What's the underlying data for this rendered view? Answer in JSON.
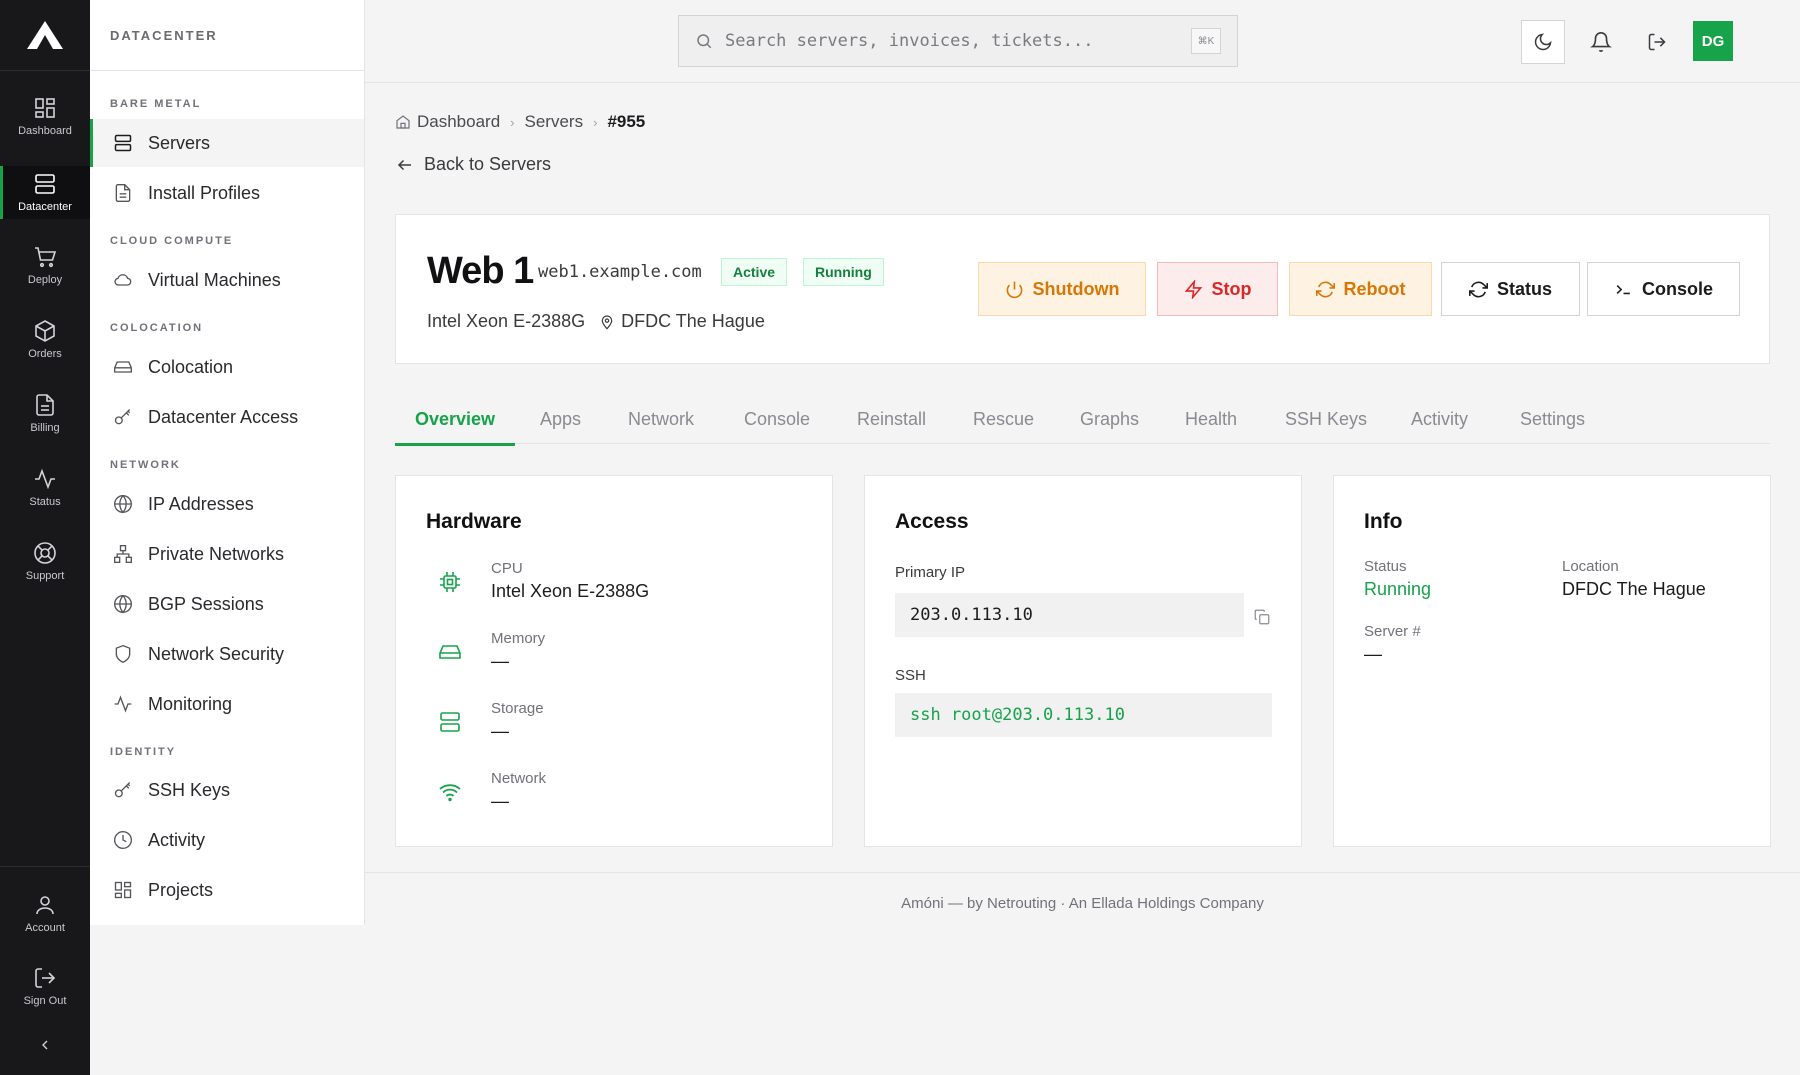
{
  "rail": {
    "items": [
      {
        "label": "Dashboard",
        "icon": "dashboard-icon"
      },
      {
        "label": "Datacenter",
        "icon": "server-icon"
      },
      {
        "label": "Deploy",
        "icon": "cart-icon"
      },
      {
        "label": "Orders",
        "icon": "box-icon"
      },
      {
        "label": "Billing",
        "icon": "document-icon"
      },
      {
        "label": "Status",
        "icon": "activity-icon"
      },
      {
        "label": "Support",
        "icon": "lifebuoy-icon"
      }
    ],
    "bottom": [
      {
        "label": "Account",
        "icon": "user-icon"
      },
      {
        "label": "Sign Out",
        "icon": "sign-out-icon"
      }
    ]
  },
  "sidebar": {
    "title": "DATACENTER",
    "sections": {
      "bare_metal": "BARE METAL",
      "cloud_compute": "CLOUD COMPUTE",
      "colocation": "COLOCATION",
      "network": "NETWORK",
      "identity": "IDENTITY"
    },
    "items": {
      "servers": "Servers",
      "install_profiles": "Install Profiles",
      "virtual_machines": "Virtual Machines",
      "colocation": "Colocation",
      "datacenter_access": "Datacenter Access",
      "ip_addresses": "IP Addresses",
      "private_networks": "Private Networks",
      "bgp_sessions": "BGP Sessions",
      "network_security": "Network Security",
      "monitoring": "Monitoring",
      "ssh_keys": "SSH Keys",
      "activity": "Activity",
      "projects": "Projects"
    }
  },
  "topbar": {
    "search_placeholder": "Search servers, invoices, tickets...",
    "shortcut": "⌘K",
    "avatar_initials": "DG"
  },
  "breadcrumb": {
    "home": "Dashboard",
    "servers": "Servers",
    "current": "#955"
  },
  "back_label": "Back to Servers",
  "server": {
    "name": "Web 1",
    "hostname": "web1.example.com",
    "badge_active": "Active",
    "badge_running": "Running",
    "cpu": "Intel Xeon E-2388G",
    "location": "DFDC The Hague"
  },
  "actions": {
    "shutdown": "Shutdown",
    "stop": "Stop",
    "reboot": "Reboot",
    "status": "Status",
    "console": "Console"
  },
  "tabs": [
    "Overview",
    "Apps",
    "Network",
    "Console",
    "Reinstall",
    "Rescue",
    "Graphs",
    "Health",
    "SSH Keys",
    "Activity",
    "Settings"
  ],
  "hardware": {
    "title": "Hardware",
    "cpu_label": "CPU",
    "cpu_value": "Intel Xeon E-2388G",
    "memory_label": "Memory",
    "memory_value": "—",
    "storage_label": "Storage",
    "storage_value": "—",
    "network_label": "Network",
    "network_value": "—"
  },
  "access": {
    "title": "Access",
    "primary_ip_label": "Primary IP",
    "primary_ip": "203.0.113.10",
    "ssh_label": "SSH",
    "ssh_command": "ssh root@203.0.113.10"
  },
  "info": {
    "title": "Info",
    "status_label": "Status",
    "status_value": "Running",
    "location_label": "Location",
    "location_value": "DFDC The Hague",
    "server_num_label": "Server #",
    "server_num_value": "—"
  },
  "footer": "Amóni — by Netrouting · An Ellada Holdings Company",
  "colors": {
    "accent": "#16a34a",
    "rail_bg": "#18181b",
    "warning": "#d97706",
    "danger": "#dc2626"
  }
}
